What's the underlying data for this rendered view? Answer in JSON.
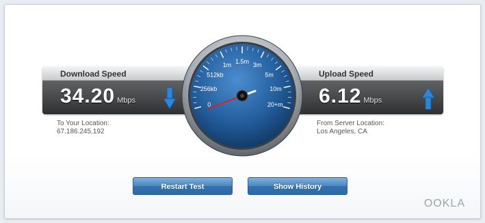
{
  "download": {
    "label": "Download Speed",
    "value": "34.20",
    "unit": "Mbps",
    "location_label": "To Your Location:",
    "location_value": "67.186.245.192"
  },
  "upload": {
    "label": "Upload Speed",
    "value": "6.12",
    "unit": "Mbps",
    "location_label": "From Server Location:",
    "location_value": "Los Angeles, CA"
  },
  "gauge": {
    "ticks": [
      "0",
      "256kb",
      "512kb",
      "1m",
      "1.5m",
      "3m",
      "5m",
      "10m",
      "20+m"
    ]
  },
  "buttons": {
    "restart": "Restart Test",
    "history": "Show History"
  },
  "logo": "OOKLA",
  "colors": {
    "accent": "#2f86d8",
    "gauge_face": "#1f4f86",
    "needle": "#ffffff"
  },
  "icons": {
    "download": "arrow-down-icon",
    "upload": "arrow-up-icon"
  }
}
